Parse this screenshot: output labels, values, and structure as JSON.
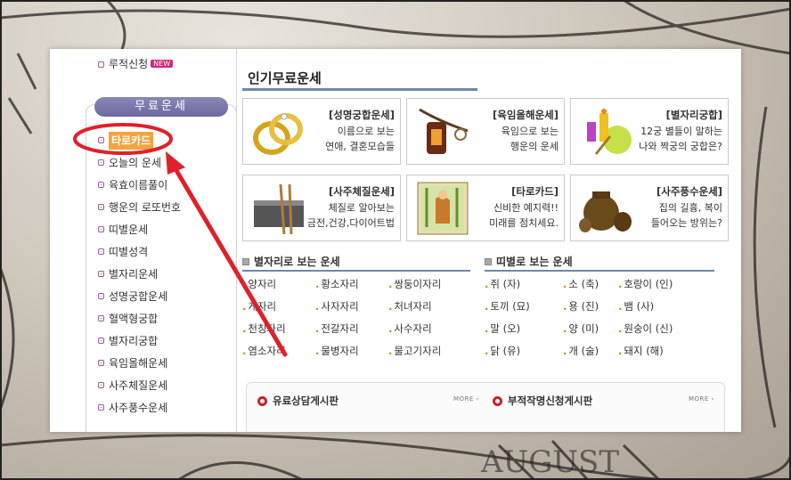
{
  "sidebar": {
    "top_item": "루적신청",
    "top_badge": "NEW",
    "section_title": "무료운세",
    "items": [
      {
        "label": "타로카드",
        "active": true
      },
      {
        "label": "오늘의 운세"
      },
      {
        "label": "육효이름풀이"
      },
      {
        "label": "행운의 로또번호"
      },
      {
        "label": "띠별운세"
      },
      {
        "label": "띠별성격"
      },
      {
        "label": "별자리운세"
      },
      {
        "label": "성명궁합운세"
      },
      {
        "label": "혈액형궁합"
      },
      {
        "label": "별자리궁합"
      },
      {
        "label": "육임올해운세"
      },
      {
        "label": "사주체질운세"
      },
      {
        "label": "사주풍수운세"
      }
    ]
  },
  "main": {
    "title": "인기무료운세",
    "cards": [
      {
        "title": "[성명궁합운세]",
        "line1": "이름으로 보는",
        "line2": "연애, 결혼모습들",
        "icon": "rings-icon"
      },
      {
        "title": "[육임올해운세]",
        "line1": "육임으로 보는",
        "line2": "행운의 운세",
        "icon": "lantern-icon"
      },
      {
        "title": "[별자리궁합]",
        "line1": "12궁 별들이 말하는",
        "line2": "나와 짝궁의 궁합은?",
        "icon": "candles-icon"
      },
      {
        "title": "[사주체질운세]",
        "line1": "체질로 알아보는",
        "line2": "금전,건강,다이어트법",
        "icon": "chopsticks-icon"
      },
      {
        "title": "[타로카드]",
        "line1": "신비한 예지력!!",
        "line2": "미래를 점치세요.",
        "icon": "tarot-card-icon"
      },
      {
        "title": "[사주풍수운세]",
        "line1": "집의 길흉, 복이",
        "line2": "들어오는 방위는?",
        "icon": "jars-icon"
      }
    ],
    "zodiac_title": "별자리로 보는 운세",
    "zodiac": [
      "양자리",
      "황소자리",
      "쌍둥이자리",
      "게자리",
      "사자자리",
      "처녀자리",
      "천칭자리",
      "전갈자리",
      "사수자리",
      "염소자리",
      "물병자리",
      "물고기자리"
    ],
    "animal_title": "띠별로 보는 운세",
    "animals": [
      "쥐 (자)",
      "소 (축)",
      "호랑이 (인)",
      "토끼 (묘)",
      "용 (진)",
      "뱀 (사)",
      "말 (오)",
      "양 (미)",
      "원숭이 (신)",
      "닭 (유)",
      "개 (술)",
      "돼지 (해)"
    ],
    "board1": "유료상담게시판",
    "board2": "부적작명신청게시판",
    "more": "MORE"
  },
  "colors": {
    "active_highlight": "#f7a33c",
    "annotation_red": "#e0202a",
    "section_underline": "#6d8aa8"
  }
}
